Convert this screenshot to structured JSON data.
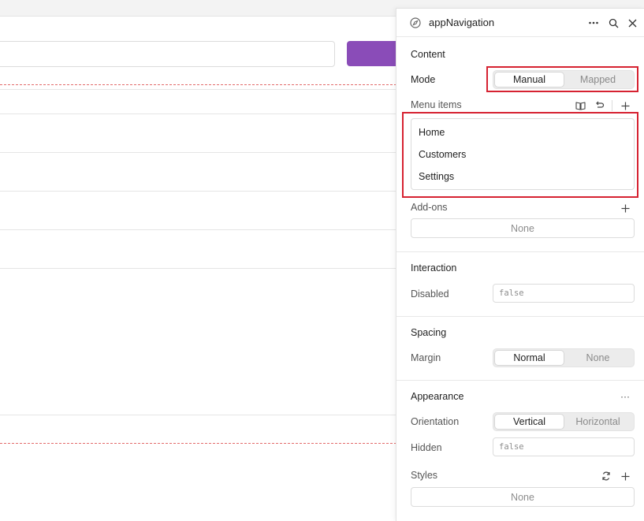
{
  "panel": {
    "title": "appNavigation",
    "header_icons": [
      "compass-icon",
      "more-icon",
      "search-icon",
      "close-icon"
    ]
  },
  "content": {
    "title": "Content",
    "mode": {
      "label": "Mode",
      "options": [
        "Manual",
        "Mapped"
      ],
      "selected": "Manual"
    },
    "menu_items": {
      "label": "Menu items",
      "items": [
        "Home",
        "Customers",
        "Settings"
      ]
    },
    "addons": {
      "label": "Add-ons",
      "value": "None"
    }
  },
  "interaction": {
    "title": "Interaction",
    "disabled": {
      "label": "Disabled",
      "value": "false"
    }
  },
  "spacing": {
    "title": "Spacing",
    "margin": {
      "label": "Margin",
      "options": [
        "Normal",
        "None"
      ],
      "selected": "Normal"
    }
  },
  "appearance": {
    "title": "Appearance",
    "more": "···",
    "orientation": {
      "label": "Orientation",
      "options": [
        "Vertical",
        "Horizontal"
      ],
      "selected": "Vertical"
    },
    "hidden": {
      "label": "Hidden",
      "value": "false"
    },
    "styles": {
      "label": "Styles",
      "value": "None"
    }
  },
  "colors": {
    "accent": "#8a4cb8",
    "highlight": "#d62231"
  }
}
